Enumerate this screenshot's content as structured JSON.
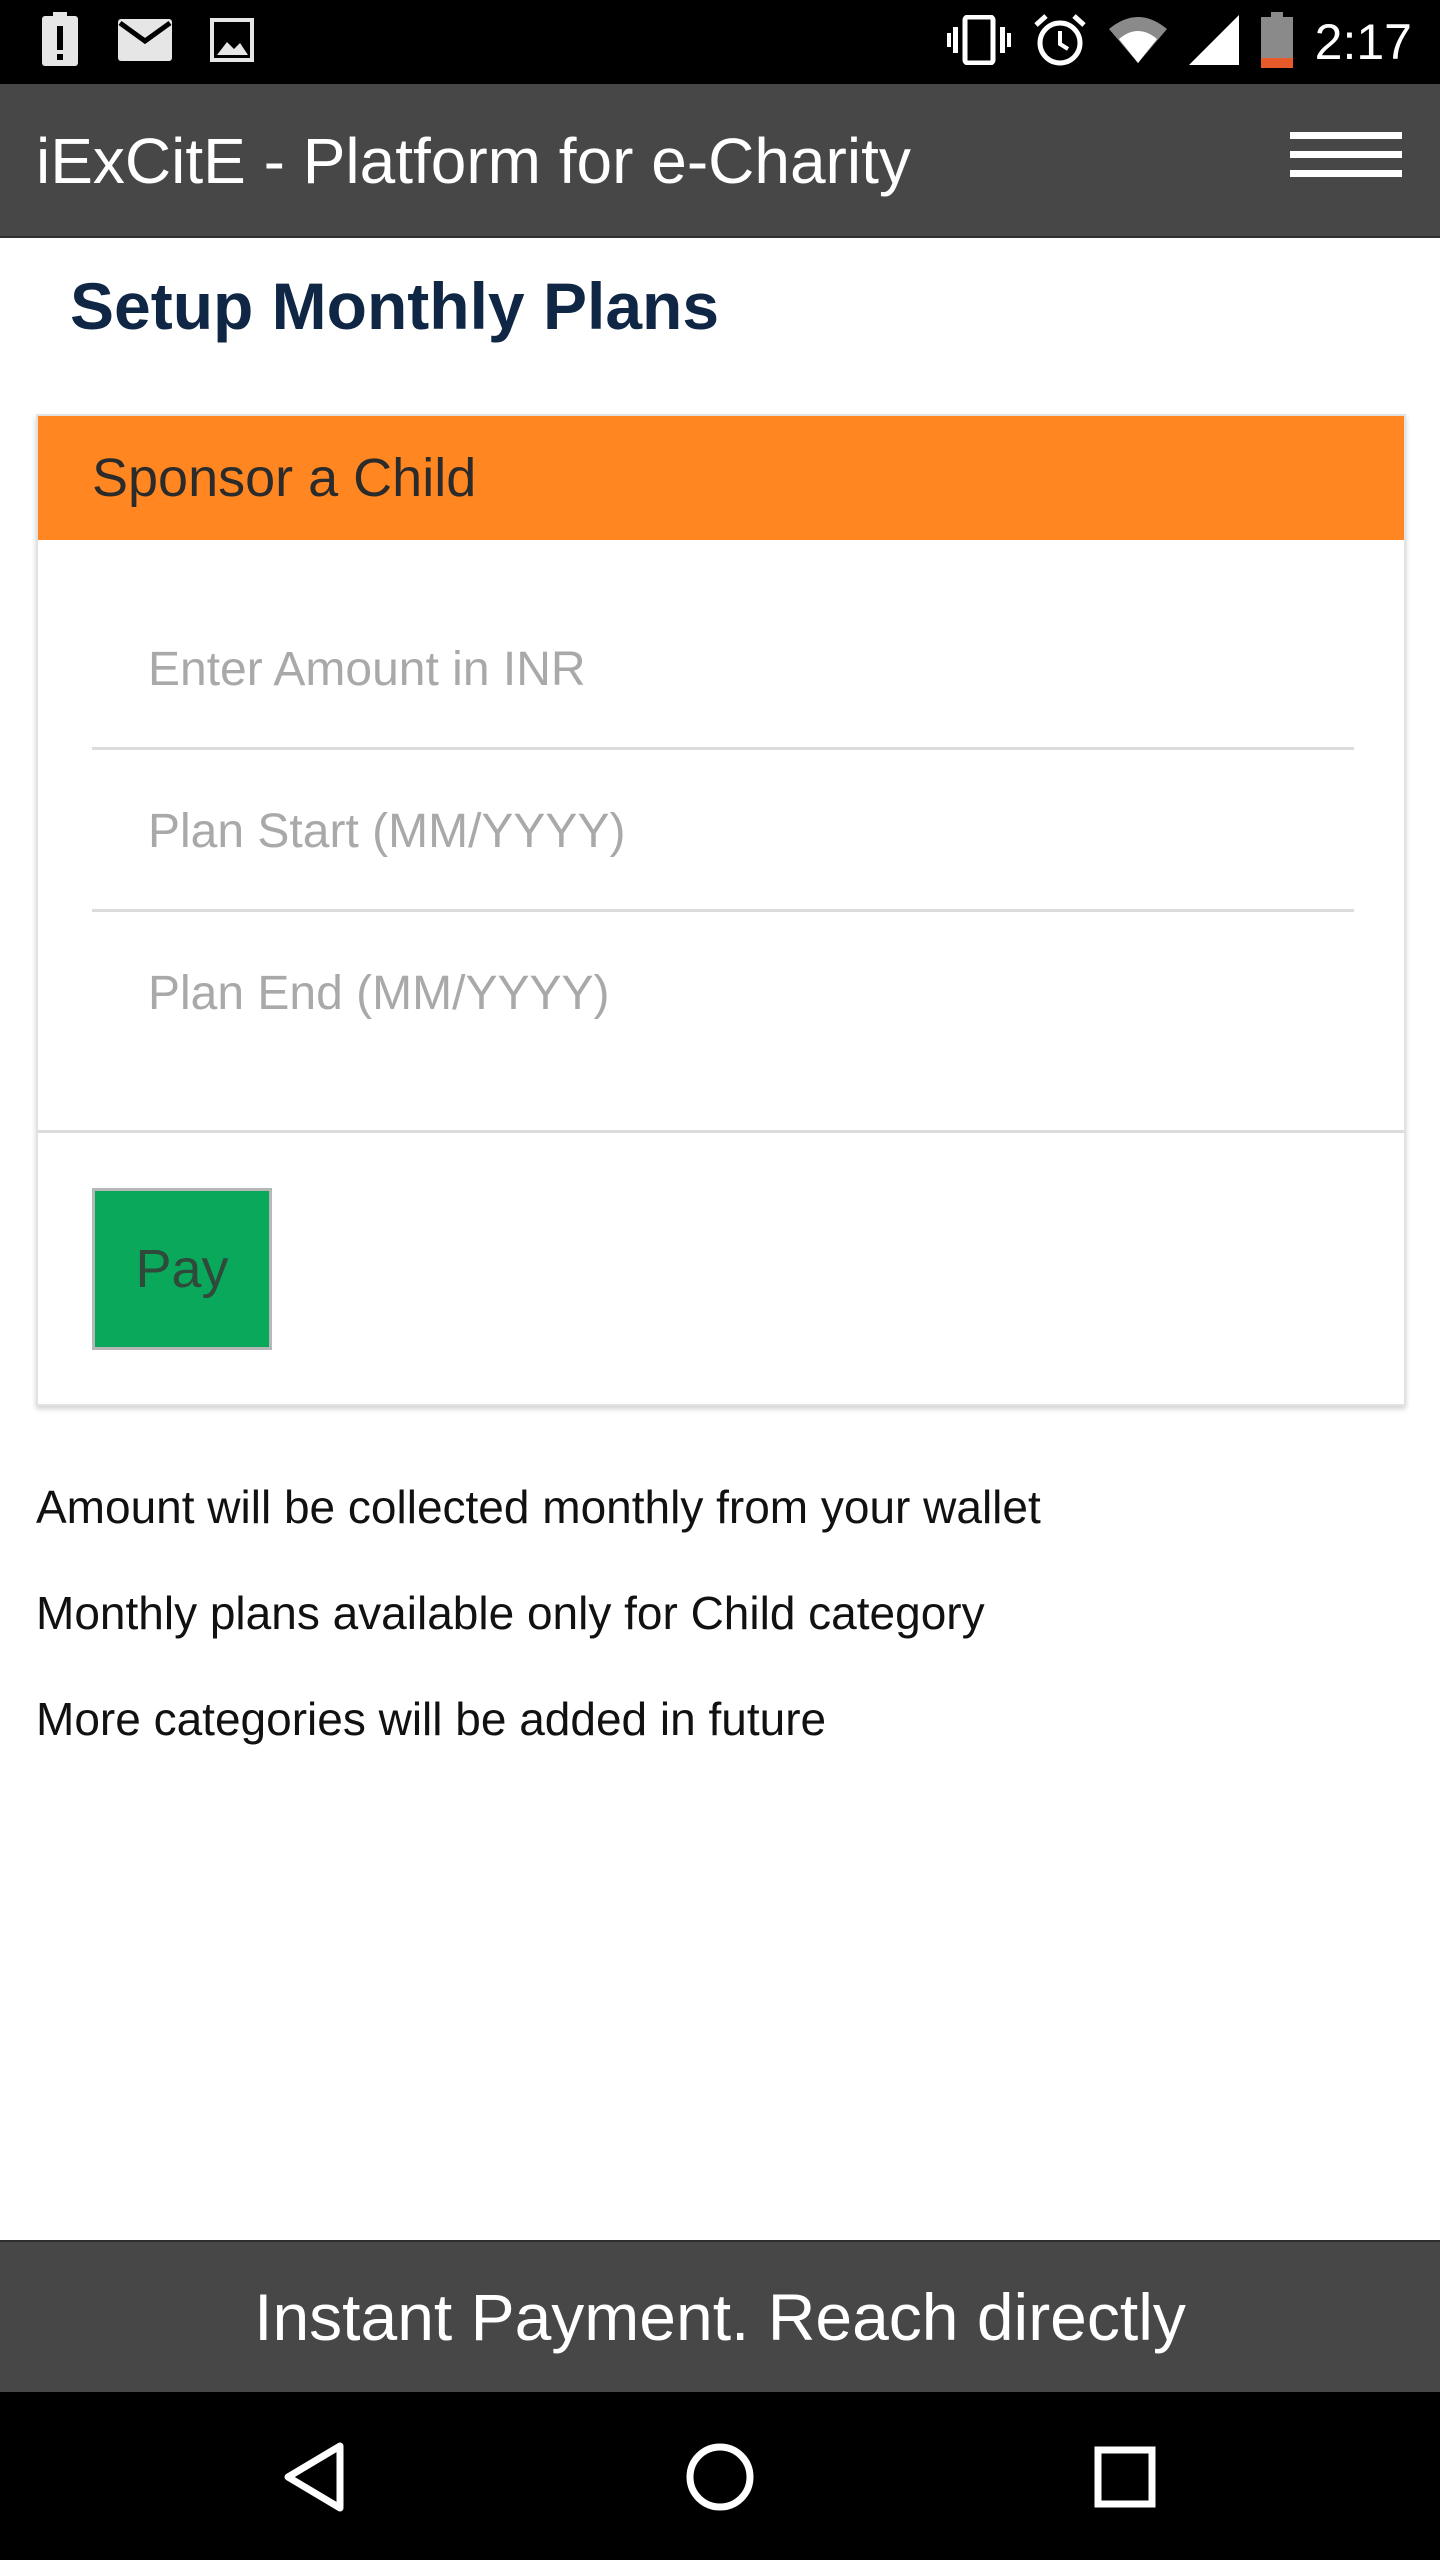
{
  "status_bar": {
    "time": "2:17",
    "icons": [
      "alert-icon",
      "mail-icon",
      "image-icon",
      "vibrate-icon",
      "alarm-icon",
      "wifi-icon",
      "signal-icon",
      "battery-low-icon"
    ]
  },
  "app_bar": {
    "title": "iExCitE - Platform for e-Charity",
    "menu_icon": "hamburger-menu-icon"
  },
  "page": {
    "title": "Setup Monthly Plans"
  },
  "card": {
    "header": "Sponsor a Child",
    "header_color": "#ff8620",
    "fields": {
      "amount_placeholder": "Enter Amount in INR",
      "start_placeholder": "Plan Start (MM/YYYY)",
      "end_placeholder": "Plan End (MM/YYYY)"
    },
    "pay_label": "Pay",
    "pay_color": "#0aa85b"
  },
  "info": {
    "line1": "Amount will be collected monthly from your wallet",
    "line2": "Monthly plans available only for Child category",
    "line3": "More categories will be added in future"
  },
  "banner": {
    "text": "Instant Payment. Reach directly"
  },
  "nav_bar": {
    "buttons": [
      "back-icon",
      "home-icon",
      "recents-icon"
    ]
  }
}
